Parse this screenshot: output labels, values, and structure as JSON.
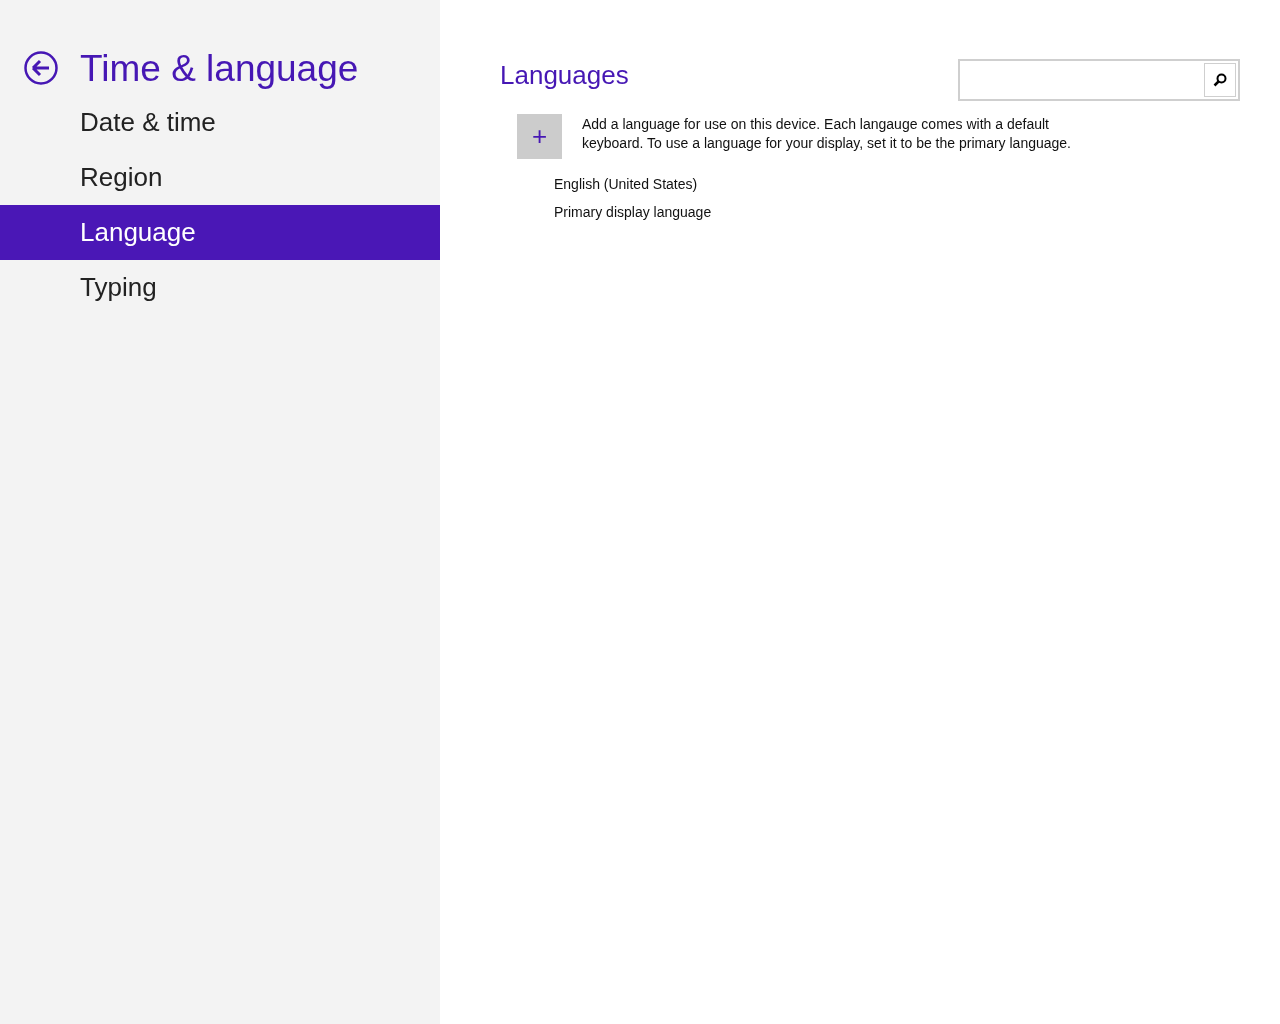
{
  "header": {
    "title": "Time & language"
  },
  "nav": [
    {
      "label": "Date & time",
      "selected": false
    },
    {
      "label": "Region",
      "selected": false
    },
    {
      "label": "Language",
      "selected": true
    },
    {
      "label": "Typing",
      "selected": false
    }
  ],
  "content": {
    "heading": "Languages",
    "add_description": "Add a language for use on this device. Each langauge comes with a default keyboard. To use a language for your display, set it to be the primary language.",
    "add_symbol": "+",
    "languages": [
      {
        "name": "English (United States)",
        "status": "Primary display language"
      }
    ]
  }
}
